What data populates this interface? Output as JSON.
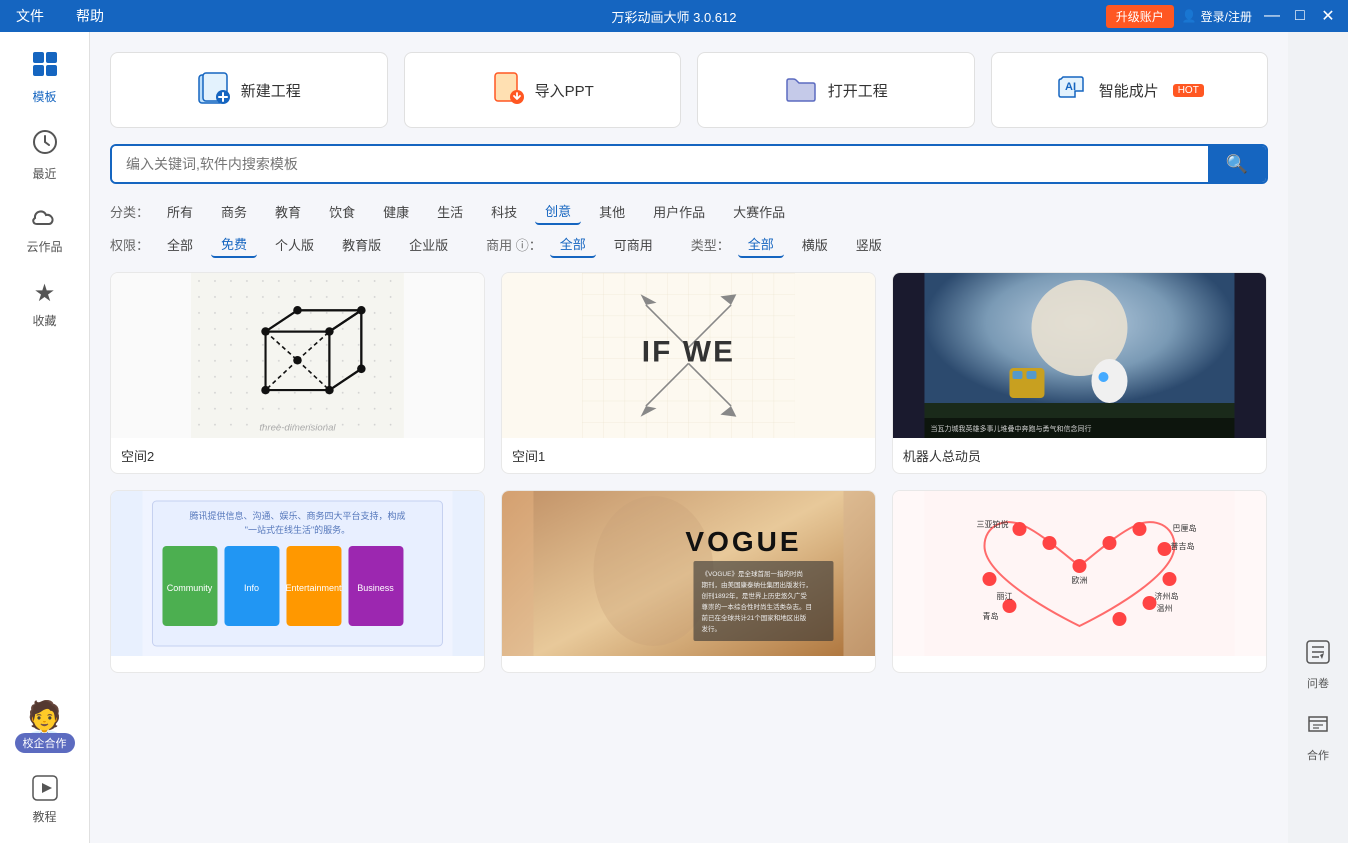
{
  "titlebar": {
    "menu_file": "文件",
    "menu_help": "帮助",
    "title": "万彩动画大师 3.0.612",
    "upgrade_label": "升级账户",
    "login_label": "登录/注册",
    "win_min": "—",
    "win_max": "□",
    "win_close": "✕"
  },
  "sidebar": {
    "items": [
      {
        "id": "templates",
        "label": "模板",
        "icon": "⊞",
        "active": true
      },
      {
        "id": "recent",
        "label": "最近",
        "icon": "🕐",
        "active": false
      },
      {
        "id": "cloud",
        "label": "云作品",
        "icon": "☁",
        "active": false
      },
      {
        "id": "favorites",
        "label": "收藏",
        "icon": "★",
        "active": false
      }
    ],
    "tutorial": {
      "label": "教程",
      "icon": "▶"
    },
    "xiaoqi": {
      "label": "校企合作"
    }
  },
  "actions": [
    {
      "id": "new-project",
      "label": "新建工程",
      "icon_color": "#1565c0"
    },
    {
      "id": "import-ppt",
      "label": "导入PPT",
      "icon_color": "#ff5722"
    },
    {
      "id": "open-project",
      "label": "打开工程",
      "icon_color": "#5c6bc0"
    },
    {
      "id": "ai-create",
      "label": "智能成片",
      "hot": true,
      "icon_color": "#1565c0"
    }
  ],
  "search": {
    "placeholder": "编入关键词,软件内搜索模板"
  },
  "filters": {
    "category": {
      "label": "分类：",
      "items": [
        "所有",
        "商务",
        "教育",
        "饮食",
        "健康",
        "生活",
        "科技",
        "创意",
        "其他",
        "用户作品",
        "大赛作品"
      ],
      "active": "创意"
    },
    "permissions": {
      "label": "权限：",
      "items": [
        "全部",
        "免费",
        "个人版",
        "教育版",
        "企业版"
      ],
      "active": "免费"
    },
    "commercial": {
      "label": "商用 ⓘ：",
      "items": [
        "全部",
        "可商用"
      ],
      "active": "全部"
    },
    "type": {
      "label": "类型：",
      "items": [
        "全部",
        "横版",
        "竖版"
      ],
      "active": "全部"
    }
  },
  "templates": [
    {
      "id": "space2",
      "title": "空间2",
      "thumb_type": "cube"
    },
    {
      "id": "space1",
      "title": "空间1",
      "thumb_type": "grid_ifwe"
    },
    {
      "id": "robot",
      "title": "机器人总动员",
      "thumb_type": "robot"
    },
    {
      "id": "tencent",
      "title": "",
      "thumb_type": "tencent"
    },
    {
      "id": "vogue",
      "title": "",
      "thumb_type": "vogue"
    },
    {
      "id": "travel",
      "title": "",
      "thumb_type": "travel_map"
    }
  ],
  "right_panel": {
    "items": [
      {
        "id": "survey",
        "label": "问卷",
        "icon": "🤝"
      },
      {
        "id": "cooperate",
        "label": "合作",
        "icon": "📄"
      }
    ]
  }
}
